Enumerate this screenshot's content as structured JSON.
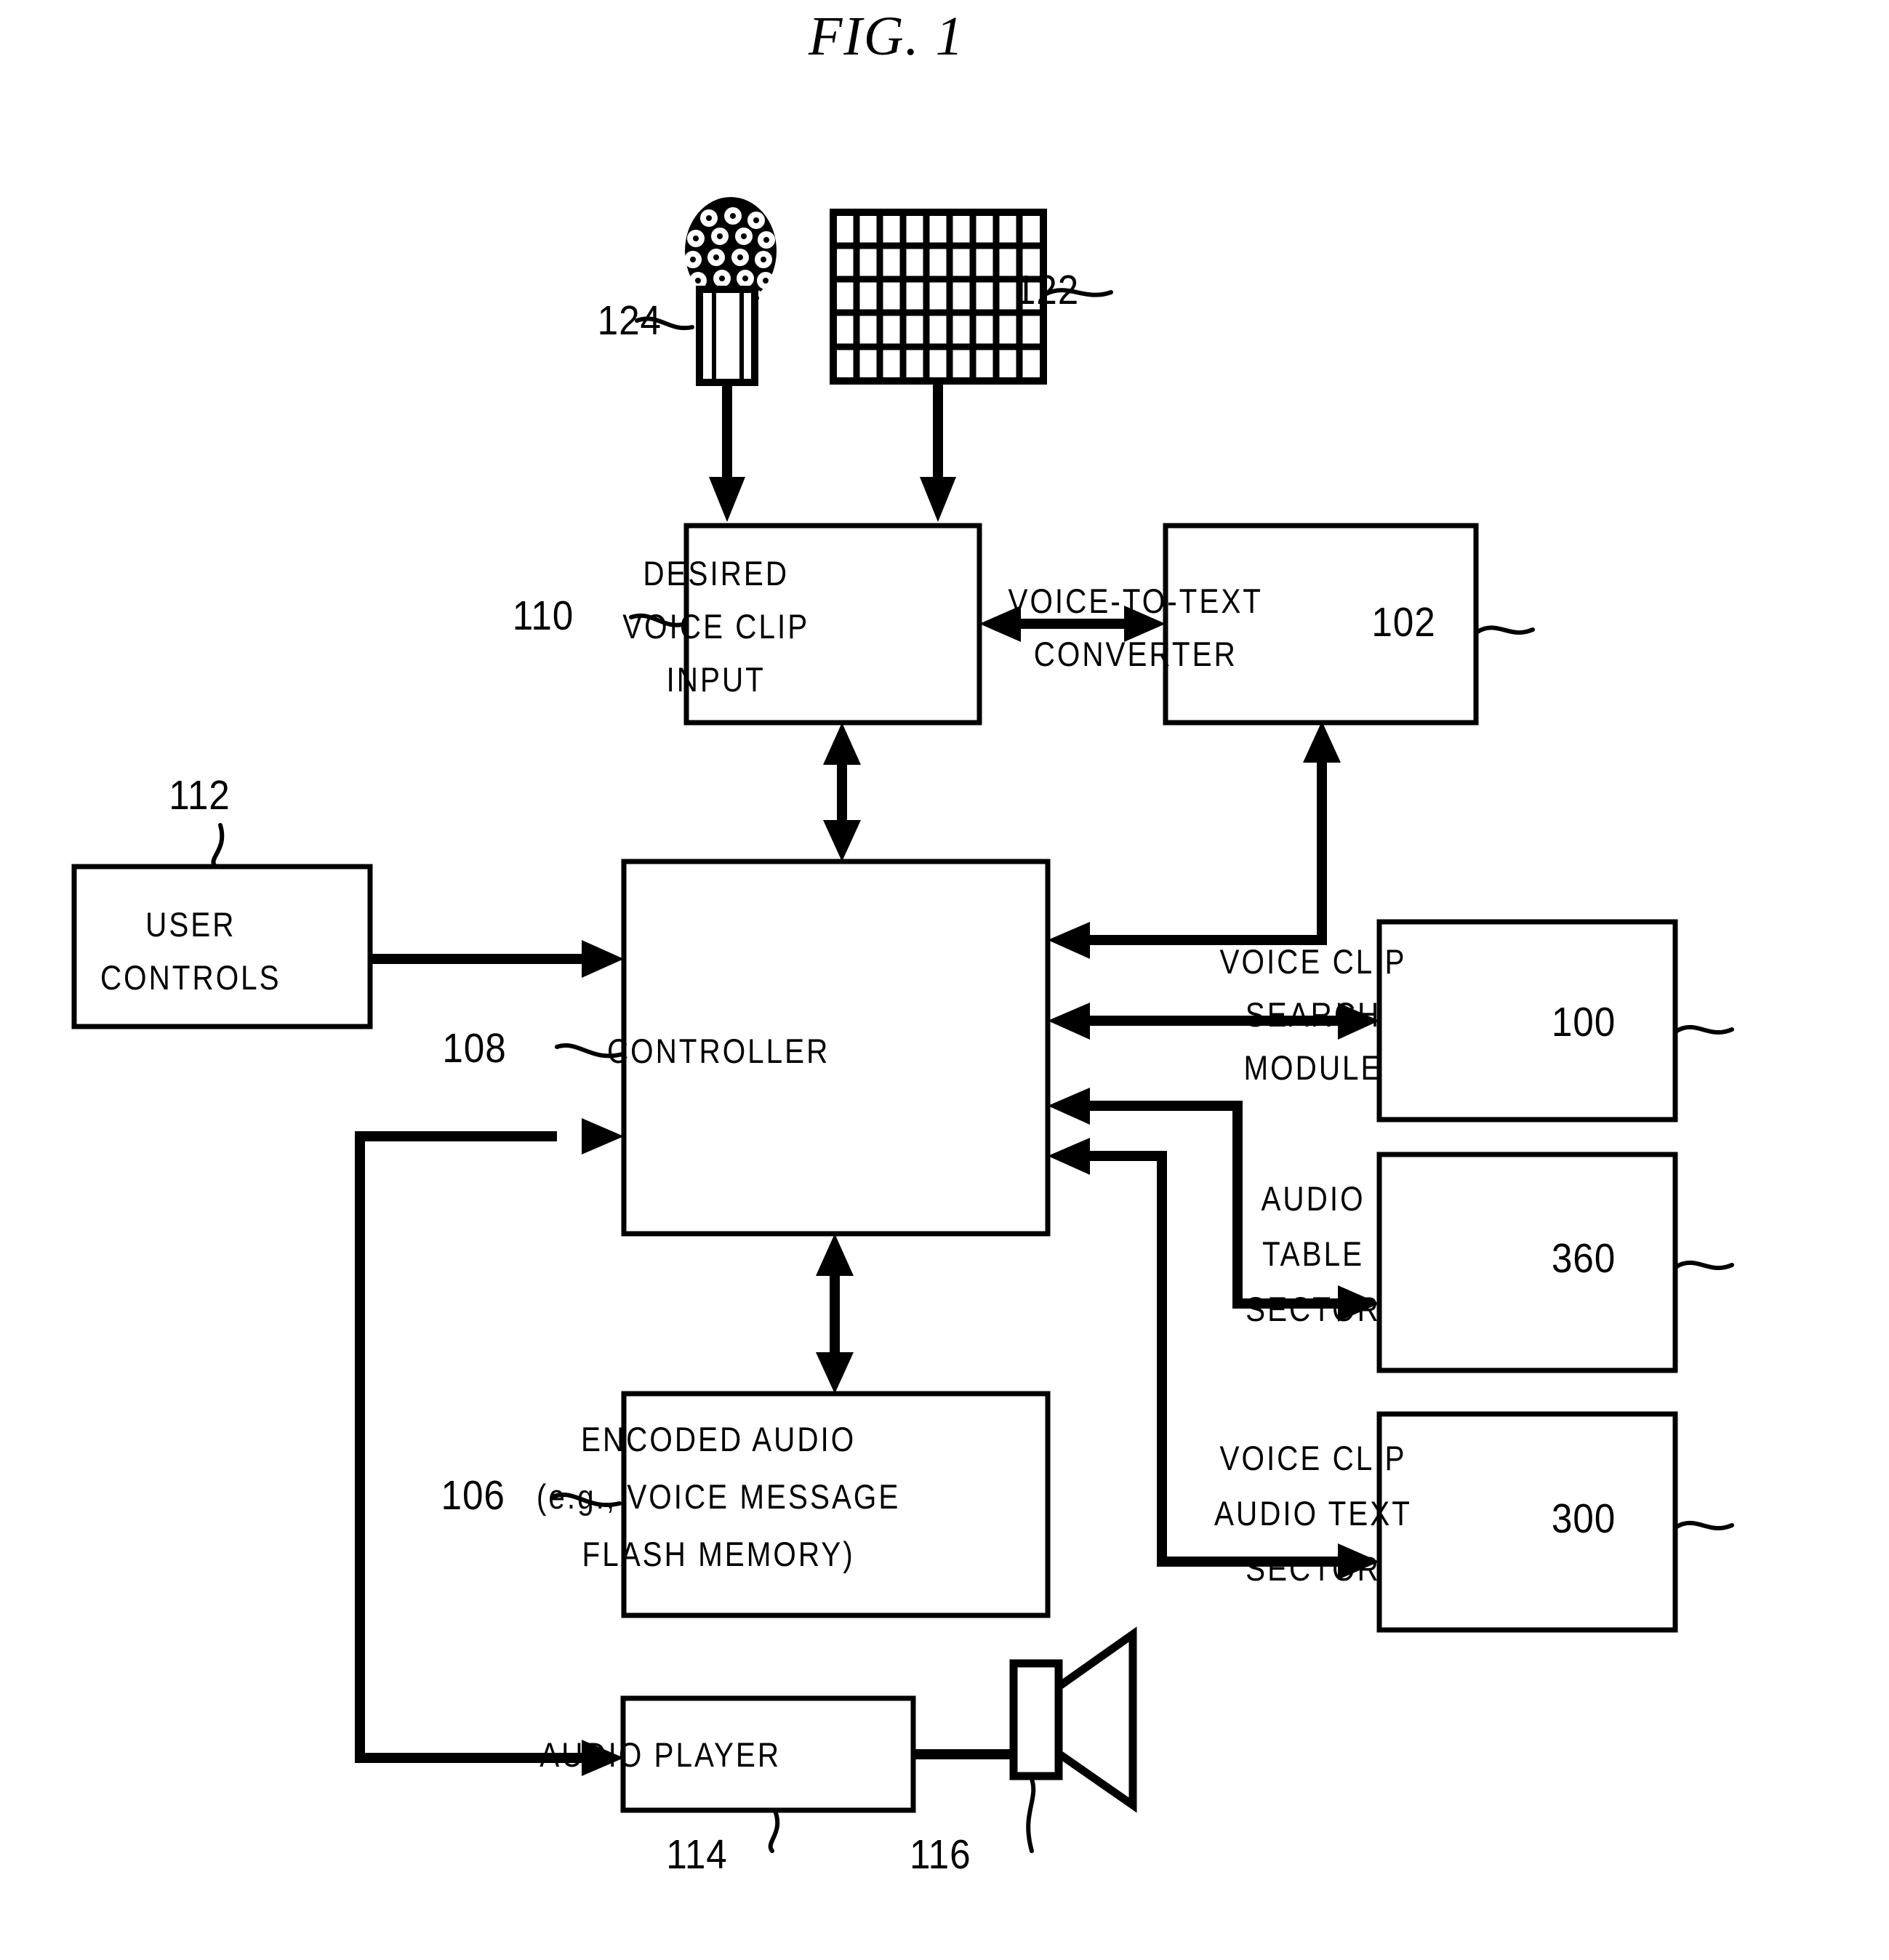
{
  "figure": {
    "title": "FIG.  1",
    "type": "patent-block-diagram"
  },
  "blocks": [
    {
      "id": "desired-voice-clip-input",
      "ref": "110",
      "lines": [
        "DESIRED",
        "VOICE CLIP",
        "INPUT"
      ]
    },
    {
      "id": "voice-to-text-converter",
      "ref": "102",
      "lines": [
        "VOICE-TO-TEXT",
        "CONVERTER"
      ]
    },
    {
      "id": "user-controls",
      "ref": "112",
      "lines": [
        "USER",
        "CONTROLS"
      ]
    },
    {
      "id": "controller",
      "ref": "108",
      "lines": [
        "CONTROLLER"
      ]
    },
    {
      "id": "voice-clip-search-module",
      "ref": "100",
      "lines": [
        "VOICE CLIP",
        "SEARCH",
        "MODULE"
      ]
    },
    {
      "id": "audio-table-sector",
      "ref": "360",
      "lines": [
        "AUDIO",
        "TABLE",
        "SECTOR"
      ]
    },
    {
      "id": "voice-clip-audio-text-sector",
      "ref": "300",
      "lines": [
        "VOICE CLIP",
        "AUDIO TEXT",
        "SECTOR"
      ]
    },
    {
      "id": "encoded-audio",
      "ref": "106",
      "lines": [
        "ENCODED AUDIO",
        "(e.g., VOICE MESSAGE",
        "FLASH MEMORY)"
      ]
    },
    {
      "id": "audio-player",
      "ref": "114",
      "lines": [
        "AUDIO PLAYER"
      ]
    }
  ],
  "icons": [
    {
      "id": "microphone",
      "ref": "124",
      "name": "microphone-icon"
    },
    {
      "id": "keypad",
      "ref": "122",
      "name": "keypad-grid-icon",
      "columns": 9,
      "rows": 5
    },
    {
      "id": "speaker",
      "ref": "116",
      "name": "speaker-icon"
    }
  ],
  "labels": {
    "b110": "110",
    "b102": "102",
    "b112": "112",
    "b108": "108",
    "b100": "100",
    "b360": "360",
    "b300": "300",
    "b106": "106",
    "b114": "114",
    "b116": "116",
    "b122": "122",
    "b124": "124"
  },
  "text": {
    "desired_l1": "DESIRED",
    "desired_l2": "VOICE CLIP",
    "desired_l3": "INPUT",
    "vtt_l1": "VOICE-TO-TEXT",
    "vtt_l2": "CONVERTER",
    "user_l1": "USER",
    "user_l2": "CONTROLS",
    "controller_l1": "CONTROLLER",
    "vcsm_l1": "VOICE CLIP",
    "vcsm_l2": "SEARCH",
    "vcsm_l3": "MODULE",
    "ats_l1": "AUDIO",
    "ats_l2": "TABLE",
    "ats_l3": "SECTOR",
    "vcats_l1": "VOICE CLIP",
    "vcats_l2": "AUDIO TEXT",
    "vcats_l3": "SECTOR",
    "enc_l1": "ENCODED AUDIO",
    "enc_l2": "(e.g., VOICE MESSAGE",
    "enc_l3": "FLASH MEMORY)",
    "player_l1": "AUDIO PLAYER",
    "title": "FIG.  1"
  },
  "colors": {
    "ink": "#000000",
    "paper": "#ffffff"
  }
}
